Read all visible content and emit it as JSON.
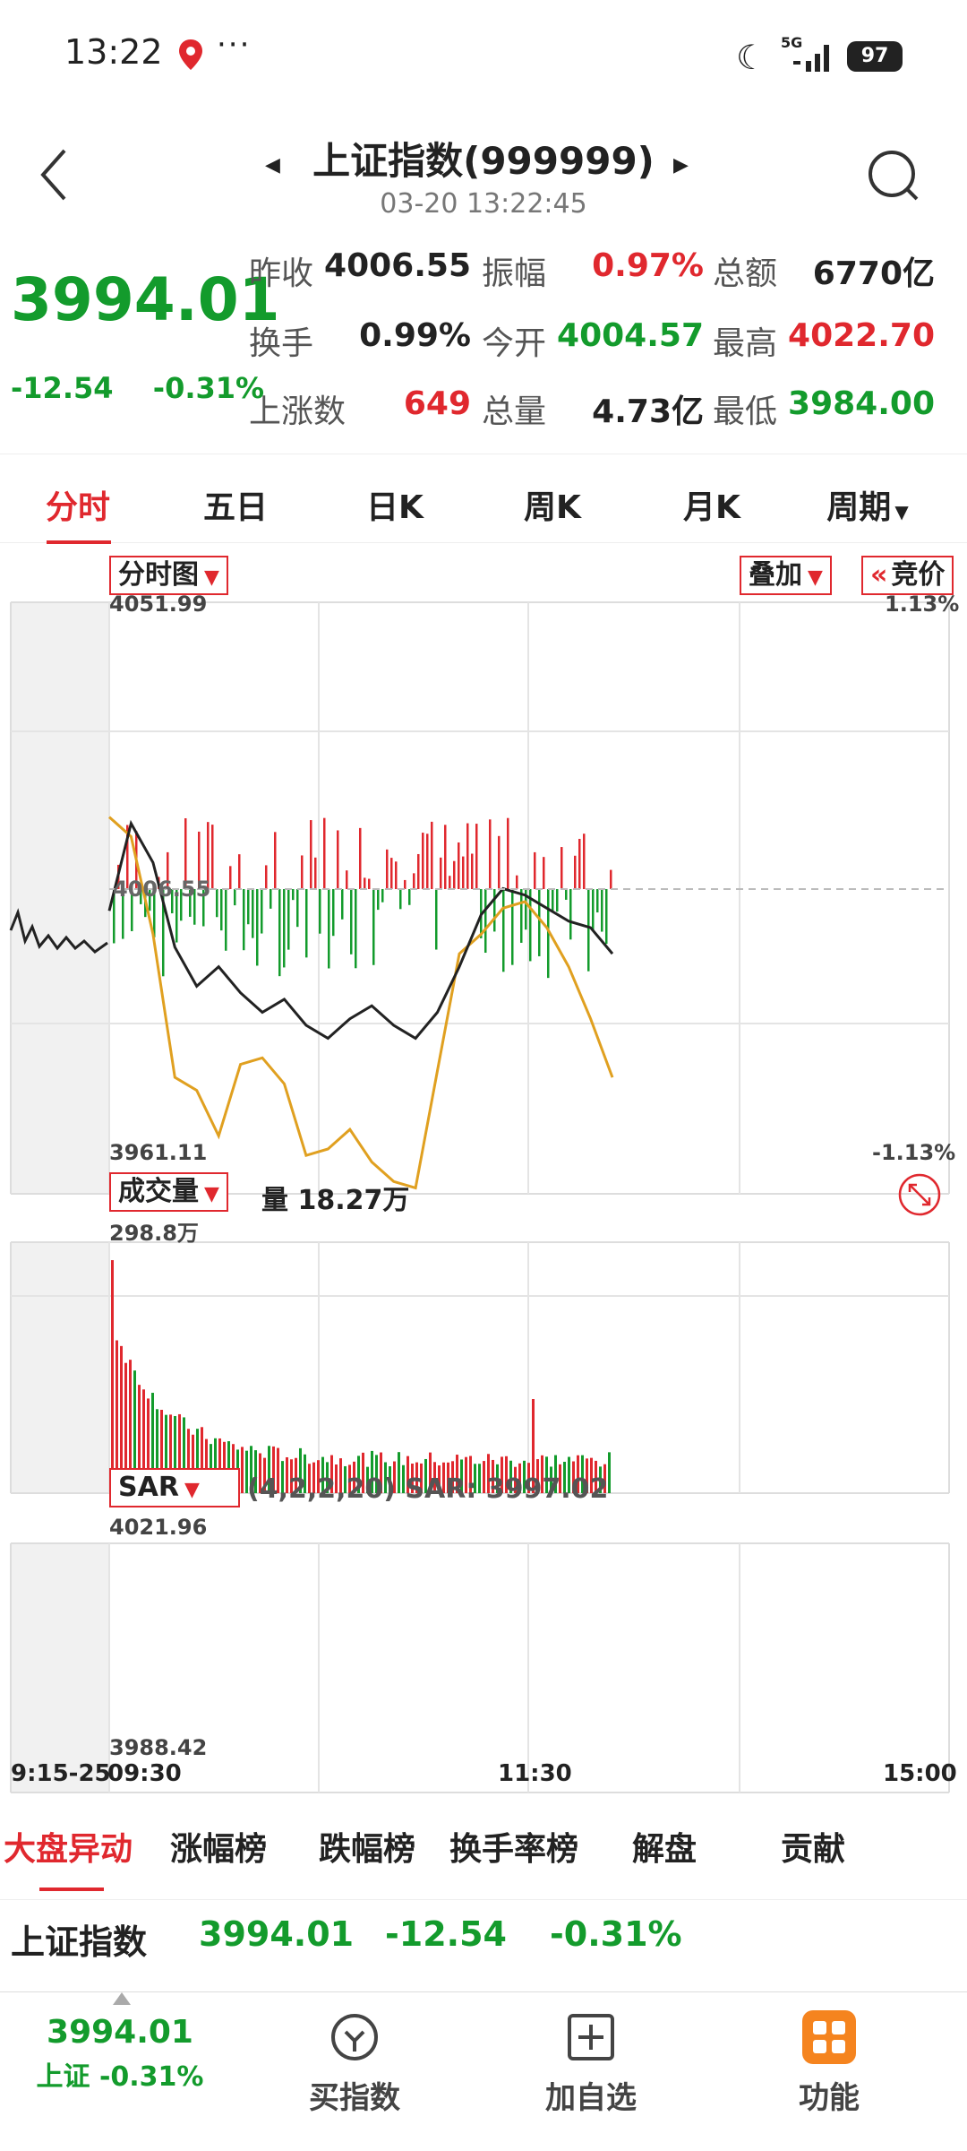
{
  "status": {
    "time": "13:22",
    "dots": "···",
    "network": "5G",
    "battery": "97"
  },
  "header": {
    "title": "上证指数(999999)",
    "datetime": "03-20 13:22:45"
  },
  "quote": {
    "price": "3994.01",
    "change": "-12.54",
    "change_pct": "-0.31%",
    "rows": [
      [
        {
          "label": "昨收",
          "value": "4006.55",
          "color": "dark"
        },
        {
          "label": "振幅",
          "value": "0.97%",
          "color": "red"
        },
        {
          "label": "总额",
          "value": "6770亿",
          "color": "dark"
        }
      ],
      [
        {
          "label": "换手",
          "value": "0.99%",
          "color": "dark"
        },
        {
          "label": "今开",
          "value": "4004.57",
          "color": "green"
        },
        {
          "label": "最高",
          "value": "4022.70",
          "color": "red"
        }
      ],
      [
        {
          "label": "上涨数",
          "value": "649",
          "color": "red"
        },
        {
          "label": "总量",
          "value": "4.73亿",
          "color": "dark"
        },
        {
          "label": "最低",
          "value": "3984.00",
          "color": "green"
        }
      ]
    ]
  },
  "tabs": [
    "分时",
    "五日",
    "日K",
    "周K",
    "月K",
    "周期"
  ],
  "chart": {
    "mode_label": "分时图",
    "overlay_label": "叠加",
    "auction_label": "竞价",
    "price_high": "4051.99",
    "price_low": "3961.11",
    "pct_high": "1.13%",
    "pct_low": "-1.13%",
    "prev_close": "4006.55",
    "volume_label": "成交量",
    "volume_value": "量 18.27万",
    "volume_max": "298.8万",
    "indicator_label": "SAR",
    "indicator_params": "(4,2,2,20) SAR: 3997.02",
    "sar_high": "4021.96",
    "sar_low": "3988.42",
    "time_labels": [
      "9:15-25",
      "09:30",
      "11:30",
      "15:00"
    ]
  },
  "chart_data": {
    "type": "line",
    "series": [
      {
        "values": [
          4004.6,
          4018,
          4012,
          3999,
          3993,
          3996,
          3992,
          3989,
          3991,
          3987,
          3985,
          3988,
          3990,
          3987,
          3985,
          3989,
          3996,
          4004,
          4008,
          4007,
          4005,
          4003,
          4002,
          3998
        ]
      },
      {
        "values": [
          4019,
          4016,
          4001,
          3979,
          3977,
          3970,
          3981,
          3982,
          3978,
          3967,
          3968,
          3971,
          3966,
          3963,
          3962,
          3980,
          3998,
          4001,
          4005,
          4006,
          4002,
          3996,
          3988,
          3979
        ]
      }
    ],
    "ylim": [
      3961.11,
      4051.99
    ]
  },
  "data_tabs": [
    "大盘异动",
    "涨幅榜",
    "跌幅榜",
    "换手率榜",
    "解盘",
    "贡献"
  ],
  "index_row": {
    "name": "上证指数",
    "price": "3994.01",
    "change": "-12.54",
    "pct": "-0.31%"
  },
  "bottom_nav": {
    "index_price": "3994.01",
    "index_label": "上证 -0.31%",
    "buy_label": "买指数",
    "add_label": "加自选",
    "func_label": "功能"
  },
  "colors": {
    "up": "#e0282e",
    "down": "#139b2c",
    "line1": "#222222",
    "line2": "#e0a020"
  }
}
